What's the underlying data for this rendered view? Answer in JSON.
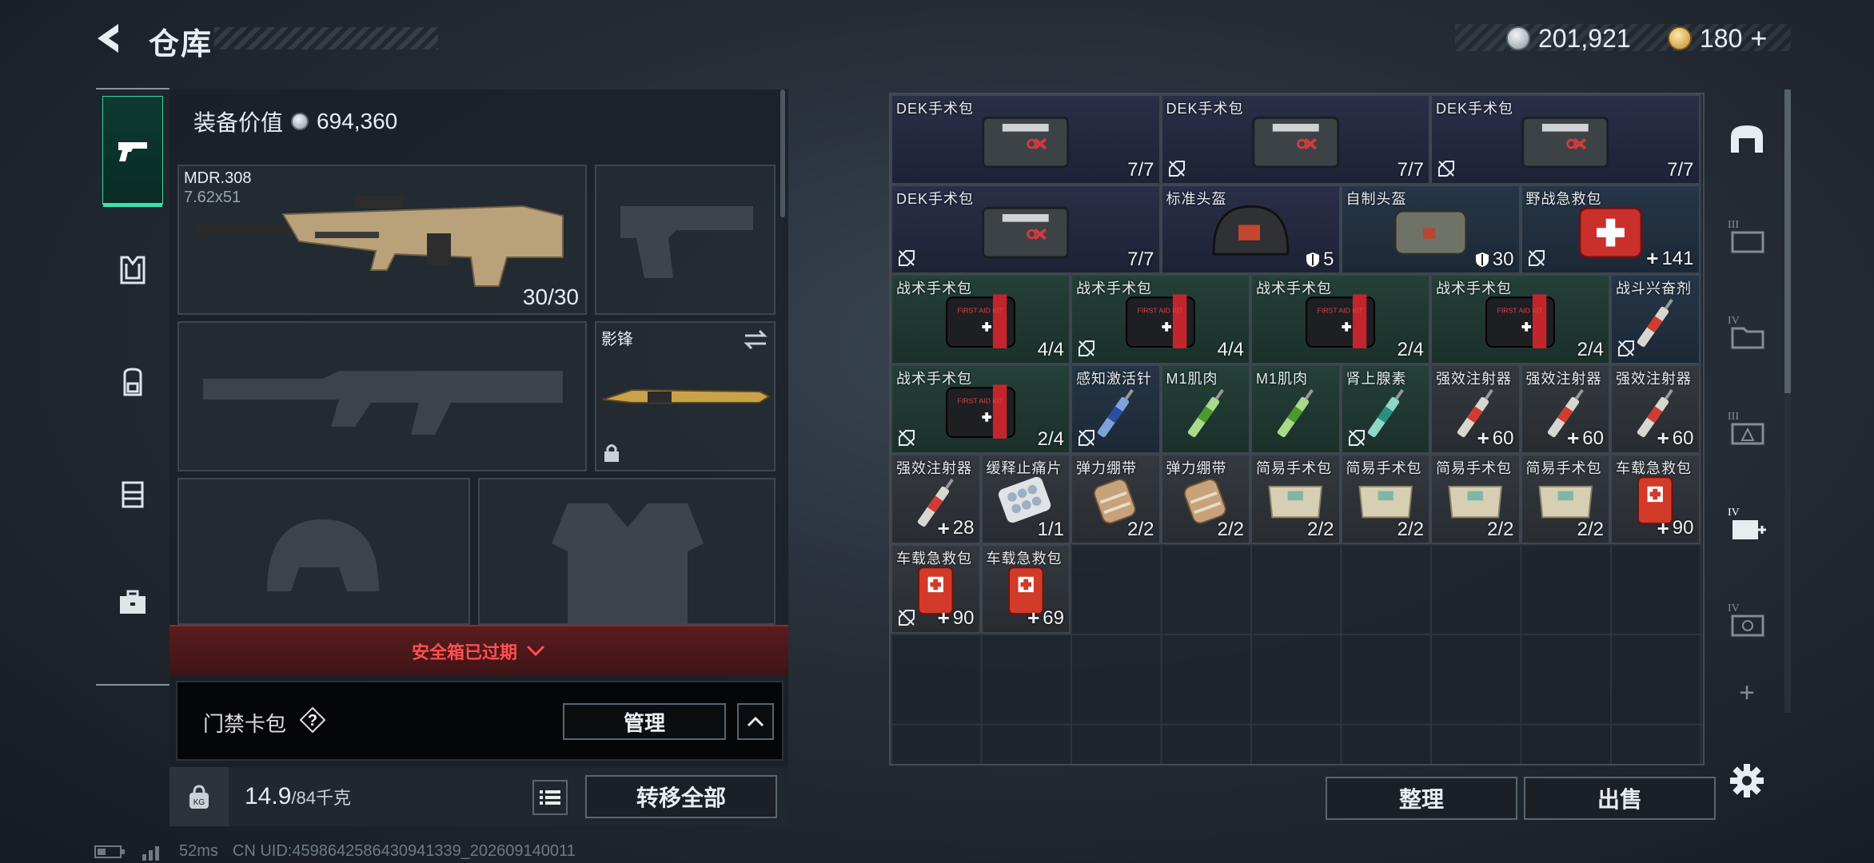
{
  "header": {
    "title": "仓库",
    "currency_silver": "201,921",
    "currency_gold": "180",
    "add_label": "+"
  },
  "loadout": {
    "equip_value_label": "装备价值",
    "equip_value": "694,360",
    "primary": {
      "name": "MDR.308",
      "caliber": "7.62x51",
      "ammo": "30/30"
    },
    "melee": {
      "name": "影锋"
    },
    "safe_expired": "安全箱已过期",
    "keycard_label": "门禁卡包",
    "manage": "管理",
    "weight": "14.9",
    "weight_max": "/84千克",
    "transfer_all": "转移全部"
  },
  "storage": {
    "items": [
      {
        "name": "DEK手术包",
        "count": "7/7"
      },
      {
        "name": "DEK手术包",
        "count": "7/7"
      },
      {
        "name": "DEK手术包",
        "count": "7/7"
      },
      {
        "name": "DEK手术包",
        "count": "7/7"
      },
      {
        "name": "标准头盔",
        "count": "5"
      },
      {
        "name": "自制头盔",
        "count": "30"
      },
      {
        "name": "野战急救包",
        "count": "141"
      },
      {
        "name": "战术手术包",
        "count": "4/4"
      },
      {
        "name": "战术手术包",
        "count": "4/4"
      },
      {
        "name": "战术手术包",
        "count": "2/4"
      },
      {
        "name": "战术手术包",
        "count": "2/4"
      },
      {
        "name": "战斗兴奋剂",
        "count": ""
      },
      {
        "name": "战术手术包",
        "count": "2/4"
      },
      {
        "name": "感知激活针",
        "count": ""
      },
      {
        "name": "M1肌肉",
        "count": ""
      },
      {
        "name": "M1肌肉",
        "count": ""
      },
      {
        "name": "肾上腺素",
        "count": ""
      },
      {
        "name": "强效注射器",
        "count": "60"
      },
      {
        "name": "强效注射器",
        "count": "60"
      },
      {
        "name": "强效注射器",
        "count": "60"
      },
      {
        "name": "强效注射器",
        "count": "28"
      },
      {
        "name": "缓释止痛片",
        "count": "1/1"
      },
      {
        "name": "弹力绷带",
        "count": "2/2"
      },
      {
        "name": "弹力绷带",
        "count": "2/2"
      },
      {
        "name": "简易手术包",
        "count": "2/2"
      },
      {
        "name": "简易手术包",
        "count": "2/2"
      },
      {
        "name": "简易手术包",
        "count": "2/2"
      },
      {
        "name": "简易手术包",
        "count": "2/2"
      },
      {
        "name": "车载急救包",
        "count": "90"
      },
      {
        "name": "车载急救包",
        "count": "90"
      },
      {
        "name": "车载急救包",
        "count": "69"
      }
    ],
    "sort": "整理",
    "sell": "出售"
  },
  "right_rail": {
    "tiers": [
      "III",
      "IV",
      "III",
      "IV",
      "IV"
    ],
    "add": "+"
  },
  "status": {
    "ping": "52ms",
    "uid": "CN UID:459864258643094133​9_202609140011"
  },
  "colors": {
    "accent": "#3fe0ad",
    "alert": "#ff4f52",
    "panel": "#1a2027"
  }
}
